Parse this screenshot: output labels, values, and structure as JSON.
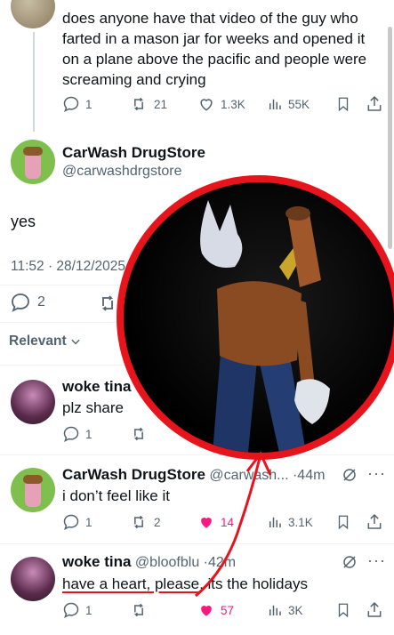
{
  "parent_tweet": {
    "text": "does anyone have that video of the guy who farted in a mason jar for weeks and opened it on a plane above the pacific and people were screaming and crying",
    "replies": "1",
    "reposts": "21",
    "likes": "1.3K",
    "views": "55K"
  },
  "main_tweet": {
    "display_name": "CarWash DrugStore",
    "handle": "@carwashdrgstore",
    "text": "yes",
    "timestamp": "11:52 · 28/12/2025",
    "replies": "2"
  },
  "sort": {
    "label": "Relevant"
  },
  "replies": [
    {
      "display_name": "woke tina",
      "handle": "",
      "time": "",
      "text": "plz share",
      "replies": "1",
      "reposts": "",
      "likes": "",
      "views": ""
    },
    {
      "display_name": "CarWash DrugStore",
      "handle": "@carwash...",
      "time": "44m",
      "text": "i don’t feel like it",
      "replies": "1",
      "reposts": "2",
      "likes": "14",
      "views": "3.1K"
    },
    {
      "display_name": "woke tina",
      "handle": "@bloofblu",
      "time": "42m",
      "text_underlined": "have a heart, please",
      "text_rest": ", its the holidays",
      "replies": "1",
      "reposts": "",
      "likes": "57",
      "views": "3K"
    }
  ],
  "colors": {
    "annotation_red": "#e8141c",
    "like_pink": "#f91880",
    "muted": "#536471"
  }
}
